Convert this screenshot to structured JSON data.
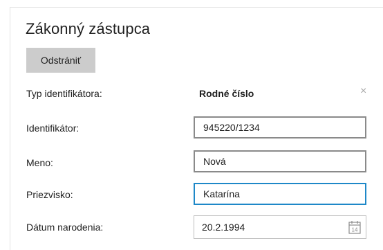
{
  "section": {
    "title": "Zákonný zástupca",
    "remove_label": "Odstrániť",
    "close_glyph": "×"
  },
  "fields": {
    "id_type": {
      "label": "Typ identifikátora:",
      "value": "Rodné číslo"
    },
    "identifier": {
      "label": "Identifikátor:",
      "value": "945220/1234"
    },
    "first_name": {
      "label": "Meno:",
      "value": "Nová"
    },
    "last_name": {
      "label": "Priezvisko:",
      "value": "Katarína"
    },
    "birth_date": {
      "label": "Dátum narodenia:",
      "value": "20.2.1994"
    }
  },
  "calendar_icon": {
    "name": "calendar-icon",
    "day": "14"
  },
  "colors": {
    "focus_border": "#1e88c8",
    "button_bg": "#cccccc",
    "field_border": "#8a8a8a"
  }
}
